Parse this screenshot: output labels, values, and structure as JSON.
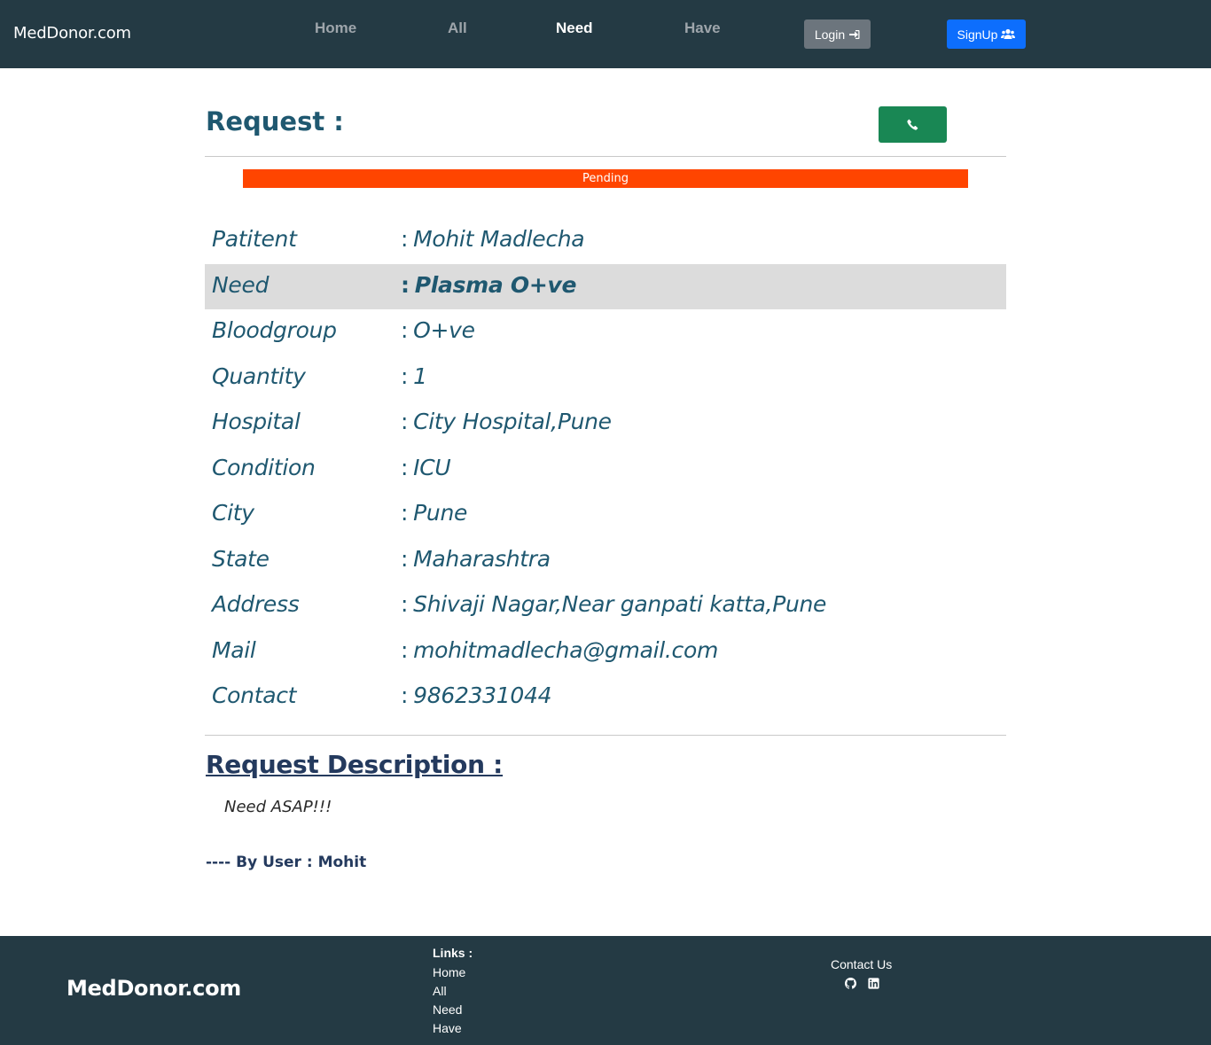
{
  "navbar": {
    "brand": "MedDonor.com",
    "links": [
      "Home",
      "All",
      "Need",
      "Have"
    ],
    "active_link": "Need",
    "login_label": "Login",
    "signup_label": "SignUp"
  },
  "request": {
    "title": "Request :",
    "call_icon": "phone-icon",
    "status": "Pending",
    "status_color": "#ff4500",
    "details": [
      {
        "label": "Patitent",
        "value": "Mohit Madlecha"
      },
      {
        "label": "Need",
        "value": "Plasma O+ve"
      },
      {
        "label": "Bloodgroup",
        "value": "O+ve"
      },
      {
        "label": "Quantity",
        "value": "1"
      },
      {
        "label": "Hospital",
        "value": "City Hospital,Pune"
      },
      {
        "label": "Condition",
        "value": "ICU"
      },
      {
        "label": "City",
        "value": "Pune"
      },
      {
        "label": "State",
        "value": "Maharashtra"
      },
      {
        "label": "Address",
        "value": "Shivaji Nagar,Near ganpati katta,Pune"
      },
      {
        "label": "Mail",
        "value": "mohitmadlecha@gmail.com"
      },
      {
        "label": "Contact",
        "value": "9862331044"
      }
    ],
    "description_title": "Request Description :",
    "description": "Need ASAP!!!",
    "by_user": "---- By User : Mohit"
  },
  "footer": {
    "brand": "MedDonor.com",
    "links_title": "Links :",
    "links": [
      "Home",
      "All",
      "Need",
      "Have"
    ],
    "contact_title": "Contact Us",
    "icons": [
      "github-icon",
      "linkedin-icon"
    ]
  },
  "colors": {
    "navbar_bg": "#243a44",
    "primary_text": "#1f5870",
    "call_button": "#198754",
    "signup_button": "#0d6efd",
    "login_button": "#6c757d"
  }
}
